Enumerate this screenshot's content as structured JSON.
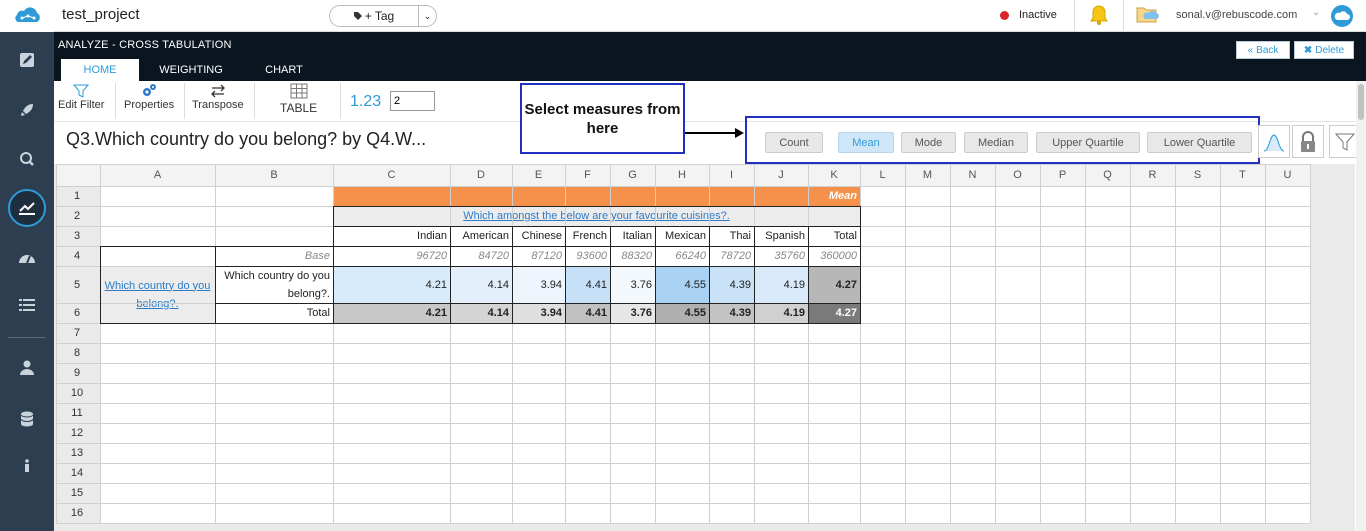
{
  "app": {
    "project_name": "test_project",
    "tag_label": "+ Tag",
    "status": "Inactive",
    "user_email": "sonal.v@rebuscode.com"
  },
  "header": {
    "breadcrumb": "ANALYZE - CROSS TABULATION",
    "tabs": [
      {
        "label": "HOME",
        "active": true
      },
      {
        "label": "WEIGHTING",
        "active": false
      },
      {
        "label": "CHART",
        "active": false
      }
    ],
    "back_label": "Back",
    "delete_label": "Delete"
  },
  "toolbar": {
    "edit_filter": "Edit Filter",
    "properties": "Properties",
    "transpose": "Transpose",
    "table": "TABLE",
    "decimals_label": "1.23",
    "decimals_value": "2"
  },
  "main": {
    "question_title": "Q3.Which country do you belong? by Q4.W...",
    "annotation": "Select measures from here",
    "measures": [
      {
        "label": "Count",
        "selected": false
      },
      {
        "label": "Mean",
        "selected": true
      },
      {
        "label": "Mode",
        "selected": false
      },
      {
        "label": "Median",
        "selected": false
      },
      {
        "label": "Upper Quartile",
        "selected": false
      },
      {
        "label": "Lower Quartile",
        "selected": false
      }
    ]
  },
  "grid": {
    "columns": [
      "A",
      "B",
      "C",
      "D",
      "E",
      "F",
      "G",
      "H",
      "I",
      "J",
      "K",
      "L",
      "M",
      "N",
      "O",
      "P",
      "Q",
      "R",
      "S",
      "T",
      "U"
    ],
    "rows": [
      "1",
      "2",
      "3",
      "4",
      "5",
      "6",
      "7",
      "8",
      "9",
      "10",
      "11",
      "12",
      "13",
      "14",
      "15",
      "16"
    ],
    "measure_label": "Mean",
    "banner_question": "Which amongst the below are your favourite cuisines?.",
    "stub_question": "Which country do you belong?.",
    "row_label": "Which country do you belong?.",
    "base_label": "Base",
    "total_label": "Total",
    "headers": [
      "Indian",
      "American",
      "Chinese",
      "French",
      "Italian",
      "Mexican",
      "Thai",
      "Spanish",
      "Total"
    ],
    "base": [
      "96720",
      "84720",
      "87120",
      "93600",
      "88320",
      "66240",
      "78720",
      "35760",
      "360000"
    ],
    "row_values": [
      "4.21",
      "4.14",
      "3.94",
      "4.41",
      "3.76",
      "4.55",
      "4.39",
      "4.19",
      "4.27"
    ],
    "total_values": [
      "4.21",
      "4.14",
      "3.94",
      "4.41",
      "3.76",
      "4.55",
      "4.39",
      "4.19",
      "4.27"
    ],
    "colors": {
      "accent": "#2e9bd6",
      "mean_header": "#f5914a",
      "sidebar": "#2c3e50"
    }
  }
}
